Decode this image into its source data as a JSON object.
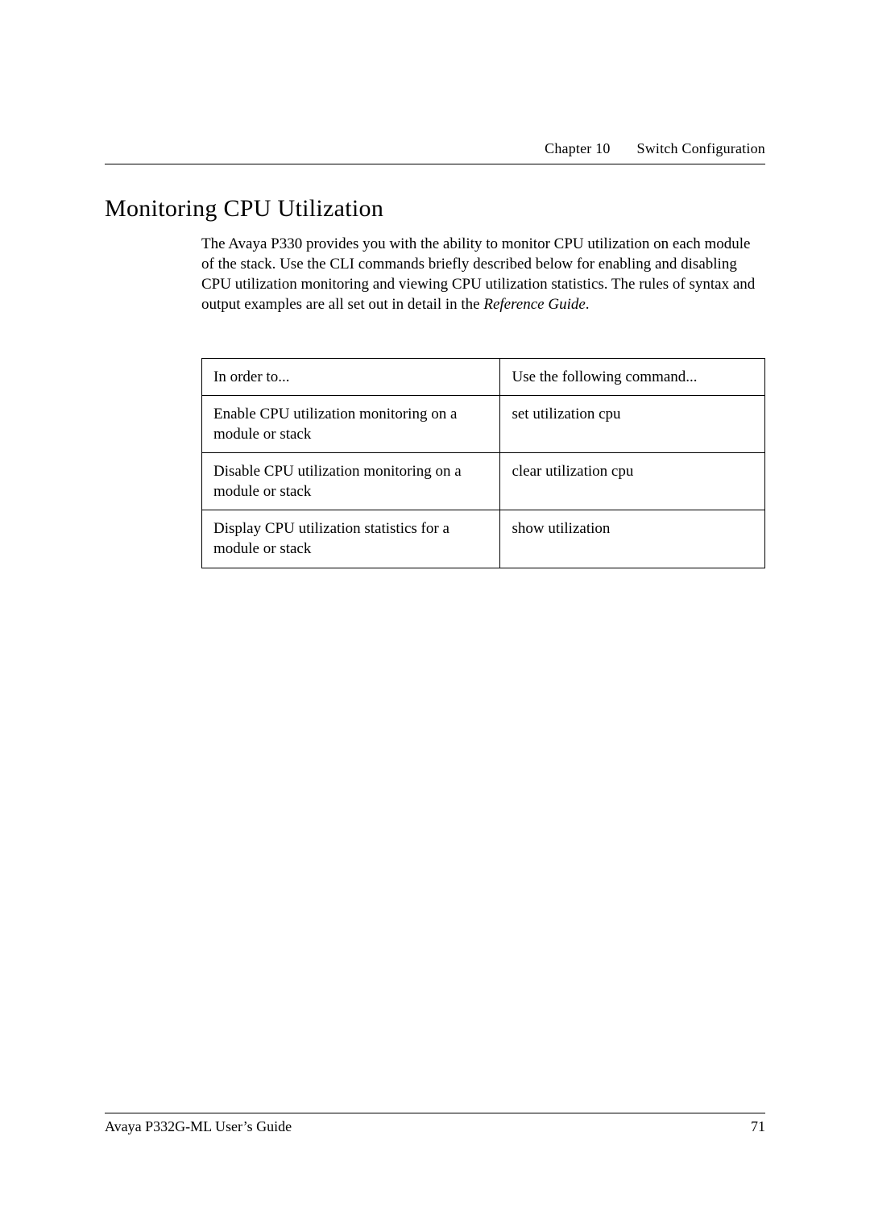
{
  "header": {
    "chapter_label": "Chapter 10",
    "chapter_title": "Switch Configuration"
  },
  "section": {
    "heading": "Monitoring CPU Utilization",
    "paragraph_parts": {
      "p1": "The Avaya P330 provides you with the ability to monitor CPU utilization on each module of the stack. Use the CLI commands briefly described below for enabling and disabling CPU utilization monitoring and viewing CPU utilization statistics. The rules of syntax and output examples are all set out in detail in the ",
      "p_em": "Reference Guide",
      "p2": "."
    }
  },
  "table": {
    "header": {
      "col1": "In order to...",
      "col2": "Use the following command..."
    },
    "rows": [
      {
        "col1": "Enable CPU utilization monitoring on a module or stack",
        "col2": "set utilization cpu"
      },
      {
        "col1": "Disable CPU utilization monitoring on a module or stack",
        "col2": "clear utilization cpu"
      },
      {
        "col1": "Display CPU utilization statistics for a module or stack",
        "col2": "show utilization"
      }
    ]
  },
  "footer": {
    "left": "Avaya P332G-ML User’s Guide",
    "right": "71"
  }
}
